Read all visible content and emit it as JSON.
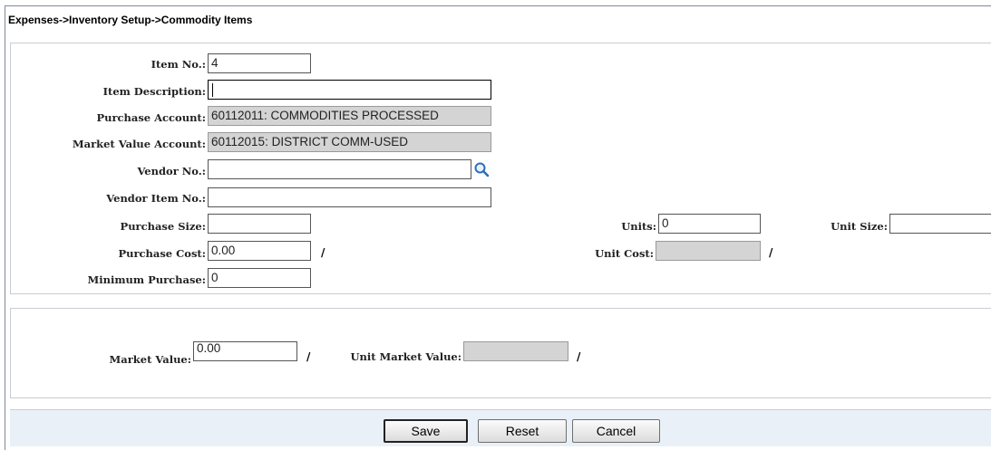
{
  "breadcrumb": "Expenses->Inventory Setup->Commodity Items",
  "form": {
    "item_no": {
      "label": "Item No.:",
      "value": "4"
    },
    "item_description": {
      "label": "Item Description:",
      "value": ""
    },
    "purchase_account": {
      "label": "Purchase Account:",
      "value": "60112011: COMMODITIES PROCESSED"
    },
    "market_value_account": {
      "label": "Market Value Account:",
      "value": "60112015: DISTRICT COMM-USED"
    },
    "vendor_no": {
      "label": "Vendor No.:",
      "value": ""
    },
    "vendor_item_no": {
      "label": "Vendor Item No.:",
      "value": ""
    },
    "purchase_size": {
      "label": "Purchase Size:",
      "value": ""
    },
    "units": {
      "label": "Units:",
      "value": "0"
    },
    "unit_size": {
      "label": "Unit Size:",
      "value": ""
    },
    "purchase_cost": {
      "label": "Purchase Cost:",
      "value": "0.00"
    },
    "unit_cost": {
      "label": "Unit Cost:",
      "value": ""
    },
    "minimum_purchase": {
      "label": "Minimum Purchase:",
      "value": "0"
    },
    "slash": "/"
  },
  "market": {
    "market_value": {
      "label": "Market Value:",
      "value": "0.00"
    },
    "unit_market_value": {
      "label": "Unit Market Value:",
      "value": ""
    }
  },
  "buttons": {
    "save": "Save",
    "reset": "Reset",
    "cancel": "Cancel"
  },
  "icons": {
    "vendor_lookup": "search-icon"
  },
  "colors": {
    "footer_bg": "#eaf0f7",
    "readonly_bg": "#d4d4d4",
    "icon_blue": "#2a6fb8"
  }
}
